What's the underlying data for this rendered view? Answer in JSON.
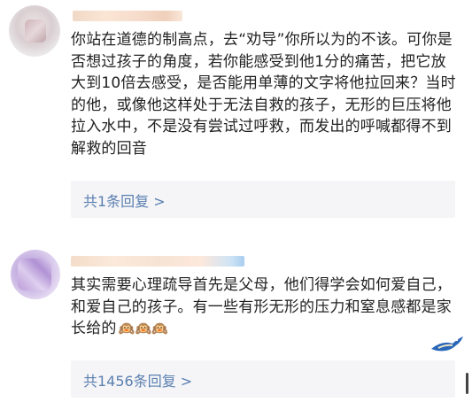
{
  "comments": [
    {
      "text": "你站在道德的制高点，去“劝导”你所以为的不该。可你是否想过孩子的角度，若你能感受到他1分的痛苦，把它放大到10倍去感受，是否能用单薄的文字将他拉回来？当时的他，或像他这样处于无法自救的孩子，无形的巨压将他拉入水中，不是没有尝试过呼救，而发出的呼喊都得不到解救的回音",
      "reply_link": "共1条回复 >"
    },
    {
      "text": "其实需要心理疏导首先是父母，他们得学会如何爱自己，和爱自己的孩子。有一些有形无形的压力和窒息感都是家长给的",
      "emoji": "🙉🙉🙉",
      "reply_link": "共1456条回复 >"
    }
  ],
  "colors": {
    "link": "#5a7fb0",
    "reply_bg": "#f5f5f7",
    "text": "#222222"
  }
}
